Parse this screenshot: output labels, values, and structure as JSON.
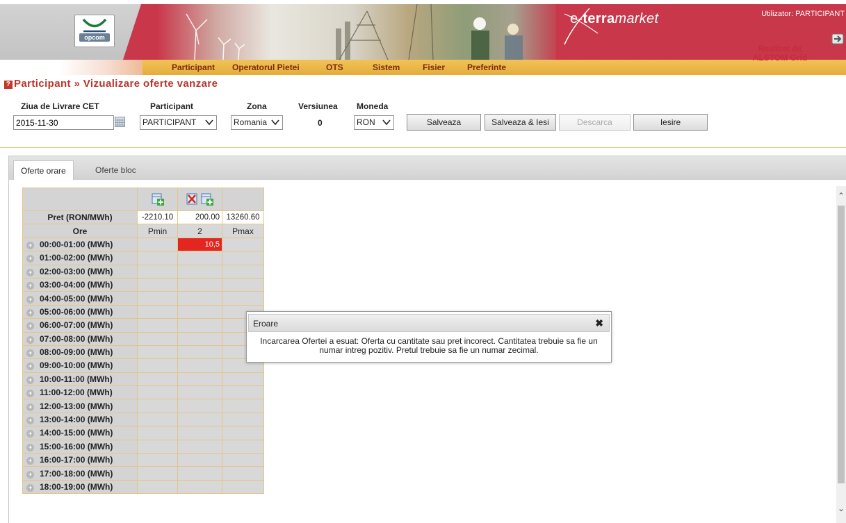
{
  "header": {
    "logo_text": "opcom",
    "brand_prefix": "e-",
    "brand_bold": "terra",
    "brand_italic": "market",
    "user_label": "Utilizator: PARTICIPANT",
    "realizat_line1": "Realizat de",
    "realizat_line2": "ALSTOM Grid"
  },
  "nav": {
    "items": [
      "Participant",
      "Operatorul Pietei",
      "OTS",
      "Sistem",
      "Fisier",
      "Preferinte"
    ]
  },
  "page": {
    "title": "Participant » Vizualizare oferte vanzare"
  },
  "form": {
    "date_label": "Ziua de Livrare CET",
    "date_value": "2015-11-30",
    "participant_label": "Participant",
    "participant_value": "PARTICIPANT",
    "zona_label": "Zona",
    "zona_value": "Romania",
    "versiunea_label": "Versiunea",
    "versiunea_value": "0",
    "moneda_label": "Moneda",
    "moneda_value": "RON"
  },
  "buttons": {
    "salveaza": "Salveaza",
    "salveaza_iesi": "Salveaza & Iesi",
    "descarca": "Descarca",
    "iesire": "Iesire"
  },
  "tabs": {
    "active": "Oferte orare",
    "inactive": "Oferte bloc"
  },
  "grid": {
    "price_label": "Pret (RON/MWh)",
    "prices": [
      "-2210.10",
      "200.00",
      "13260.60"
    ],
    "hours_label": "Ore",
    "columns": [
      "Pmin",
      "2",
      "Pmax"
    ],
    "rows": [
      {
        "label": "00:00-01:00 (MWh)",
        "v1": "",
        "v2": "10,5",
        "v3": ""
      },
      {
        "label": "01:00-02:00 (MWh)",
        "v1": "",
        "v2": "",
        "v3": ""
      },
      {
        "label": "02:00-03:00 (MWh)",
        "v1": "",
        "v2": "",
        "v3": ""
      },
      {
        "label": "03:00-04:00 (MWh)",
        "v1": "",
        "v2": "",
        "v3": ""
      },
      {
        "label": "04:00-05:00 (MWh)",
        "v1": "",
        "v2": "",
        "v3": ""
      },
      {
        "label": "05:00-06:00 (MWh)",
        "v1": "",
        "v2": "",
        "v3": ""
      },
      {
        "label": "06:00-07:00 (MWh)",
        "v1": "",
        "v2": "",
        "v3": ""
      },
      {
        "label": "07:00-08:00 (MWh)",
        "v1": "",
        "v2": "",
        "v3": ""
      },
      {
        "label": "08:00-09:00 (MWh)",
        "v1": "",
        "v2": "",
        "v3": ""
      },
      {
        "label": "09:00-10:00 (MWh)",
        "v1": "",
        "v2": "",
        "v3": ""
      },
      {
        "label": "10:00-11:00 (MWh)",
        "v1": "",
        "v2": "",
        "v3": ""
      },
      {
        "label": "11:00-12:00 (MWh)",
        "v1": "",
        "v2": "",
        "v3": ""
      },
      {
        "label": "12:00-13:00 (MWh)",
        "v1": "",
        "v2": "",
        "v3": ""
      },
      {
        "label": "13:00-14:00 (MWh)",
        "v1": "",
        "v2": "",
        "v3": ""
      },
      {
        "label": "14:00-15:00 (MWh)",
        "v1": "",
        "v2": "",
        "v3": ""
      },
      {
        "label": "15:00-16:00 (MWh)",
        "v1": "",
        "v2": "",
        "v3": ""
      },
      {
        "label": "16:00-17:00 (MWh)",
        "v1": "",
        "v2": "",
        "v3": ""
      },
      {
        "label": "17:00-18:00 (MWh)",
        "v1": "",
        "v2": "",
        "v3": ""
      },
      {
        "label": "18:00-19:00 (MWh)",
        "v1": "",
        "v2": "",
        "v3": ""
      }
    ]
  },
  "dialog": {
    "title": "Eroare",
    "close": "✖",
    "message": "Incarcarea Ofertei a esuat: Oferta cu cantitate sau pret incorect. Cantitatea trebuie sa fie un numar intreg pozitiv. Pretul trebuie sa fie un numar zecimal."
  },
  "colors": {
    "brand_red": "#c8374a",
    "nav_orange": "#e9b244",
    "error_cell": "#e3261f",
    "title_red": "#b9342b"
  }
}
